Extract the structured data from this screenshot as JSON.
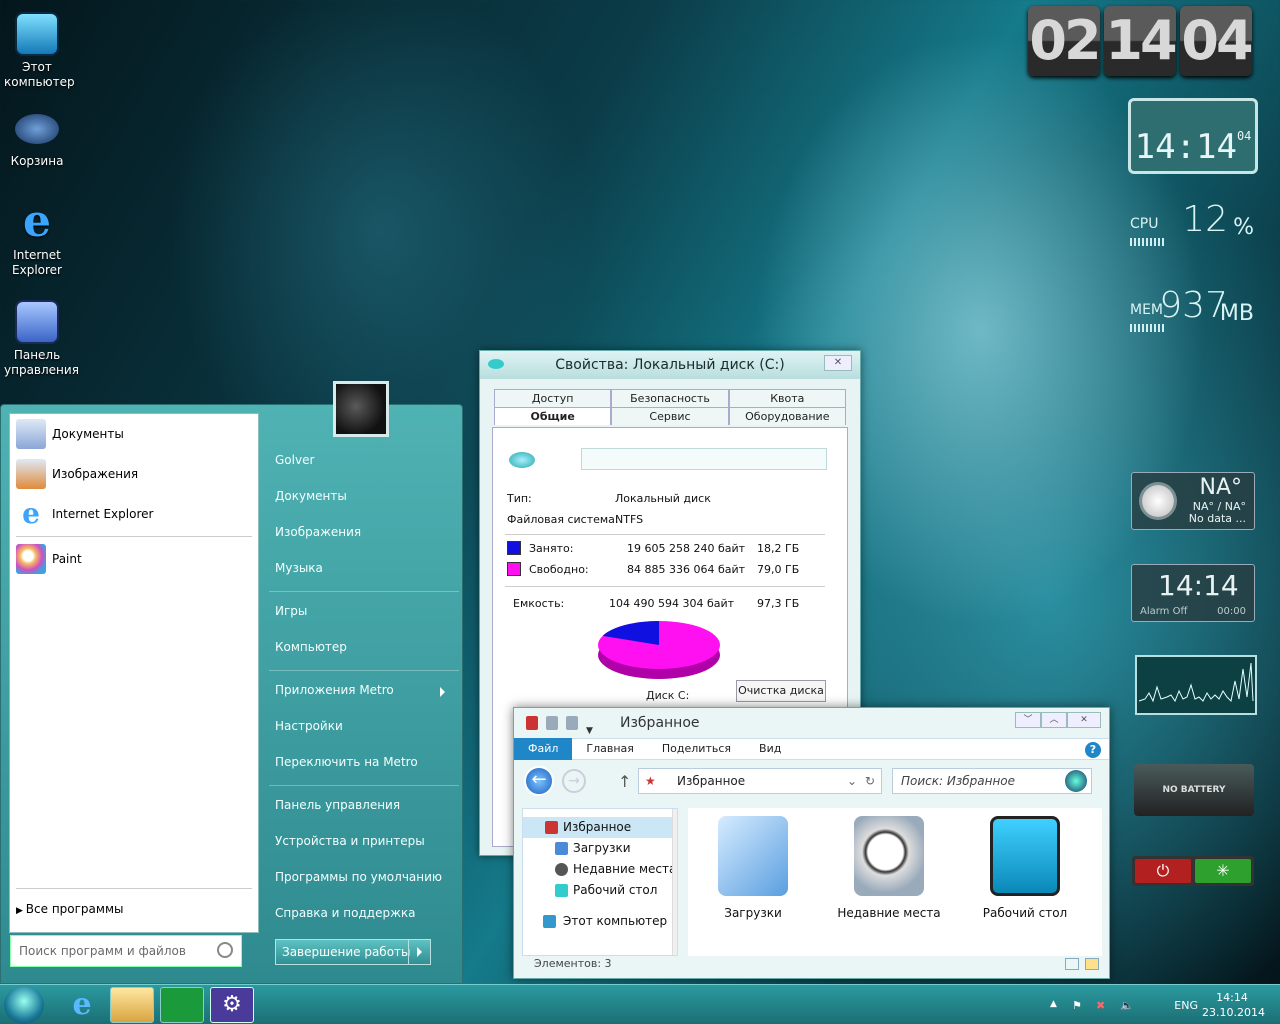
{
  "desktop": {
    "icons": [
      {
        "label": "Этот компьютер",
        "icon": "computer-icon"
      },
      {
        "label": "Корзина",
        "icon": "recycle-bin-icon"
      },
      {
        "label": "Internet Explorer",
        "icon": "ie-icon"
      },
      {
        "label": "Панель управления",
        "icon": "control-panel-icon"
      }
    ]
  },
  "gadgets": {
    "flip_clock": {
      "h": "02",
      "m": "14",
      "s": "04"
    },
    "digital_clock": {
      "time": "14:14",
      "sec": "04"
    },
    "cpu": {
      "label": "CPU",
      "value": "12",
      "unit": "%",
      "level_percent": 12
    },
    "mem": {
      "label": "MEM",
      "value": "937",
      "unit": "MB"
    },
    "weather": {
      "temp": "NA°",
      "range": "NA° / NA°",
      "status": "No data ..."
    },
    "alarm": {
      "time": "14:14",
      "status": "Alarm Off",
      "alarm_time": "00:00"
    },
    "battery": {
      "label": "NO BATTERY"
    }
  },
  "start_menu": {
    "pinned": [
      {
        "label": "Документы",
        "icon": "documents-icon"
      },
      {
        "label": "Изображения",
        "icon": "pictures-icon"
      },
      {
        "label": "Internet Explorer",
        "icon": "ie-icon"
      },
      {
        "label": "Paint",
        "icon": "paint-icon"
      }
    ],
    "all_programs": "Все программы",
    "search_placeholder": "Поиск программ и файлов",
    "right": [
      "Golver",
      "Документы",
      "Изображения",
      "Музыка",
      "Игры",
      "Компьютер",
      "Приложения Metro",
      "Настройки",
      "Переключить на Metro",
      "Панель управления",
      "Устройства и принтеры",
      "Программы по умолчанию",
      "Справка и поддержка"
    ],
    "shutdown": "Завершение работы"
  },
  "properties": {
    "title": "Свойства: Локальный диск (C:)",
    "tabs_row1": [
      "Доступ",
      "Безопасность",
      "Квота"
    ],
    "tabs_row2": [
      "Общие",
      "Сервис",
      "Оборудование"
    ],
    "type_label": "Тип:",
    "type_value": "Локальный диск",
    "fs_label": "Файловая система:",
    "fs_value": "NTFS",
    "used_label": "Занято:",
    "used_bytes": "19 605 258 240 байт",
    "used_gb": "18,2 ГБ",
    "free_label": "Свободно:",
    "free_bytes": "84 885 336 064 байт",
    "free_gb": "79,0 ГБ",
    "cap_label": "Емкость:",
    "cap_bytes": "104 490 594 304 байт",
    "cap_gb": "97,3 ГБ",
    "disk_label": "Диск C:",
    "cleanup": "Очистка диска",
    "used_color": "#1010e0",
    "free_color": "#ff10f0",
    "used_fraction": 0.1876
  },
  "explorer": {
    "title": "Избранное",
    "ribbon": [
      "Файл",
      "Главная",
      "Поделиться",
      "Вид"
    ],
    "address": "Избранное",
    "search": "Поиск: Избранное",
    "nav": [
      {
        "label": "Избранное",
        "kind": "sel"
      },
      {
        "label": "Загрузки",
        "kind": "child"
      },
      {
        "label": "Недавние места",
        "kind": "child"
      },
      {
        "label": "Рабочий стол",
        "kind": "child"
      },
      {
        "label": "Этот компьютер",
        "kind": "root"
      }
    ],
    "items": [
      "Загрузки",
      "Недавние места",
      "Рабочий стол"
    ],
    "status": "Элементов: 3"
  },
  "taskbar": {
    "lang": "ENG",
    "time": "14:14",
    "date": "23.10.2014"
  }
}
